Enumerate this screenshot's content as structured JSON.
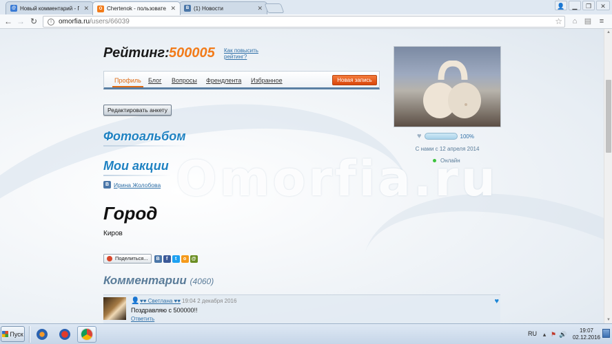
{
  "browser": {
    "tabs": [
      {
        "title": "Новый комментарий - Поч",
        "icon": "mail-icon"
      },
      {
        "title": "Chertenok - пользовател",
        "icon": "omorfia-icon"
      },
      {
        "title": "(1) Новости",
        "icon": "vk-icon"
      }
    ],
    "url_host": "omorfia.ru",
    "url_path": "/users/66039"
  },
  "watermark": "Omorfia.ru",
  "rating": {
    "label": "Рейтинг:",
    "value": "500005",
    "improve_link": "Как повысить рейтинг?"
  },
  "profile_tabs": [
    "Профиль",
    "Блог",
    "Вопросы",
    "Френдлента",
    "Избранное"
  ],
  "new_post_button": "Новая запись",
  "edit_button": "Редактировать анкету",
  "sections": {
    "photo_album": "Фотоальбом",
    "my_promos": "Мои акции"
  },
  "vk_profile": {
    "name": "Ирина Жолобова"
  },
  "city": {
    "heading": "Город",
    "value": "Киров"
  },
  "share": {
    "label": "Поделиться..."
  },
  "comments": {
    "heading": "Комментарии",
    "count": "(4060)",
    "items": [
      {
        "author": "♥♥ Светлана ♥♥",
        "date": "19:04 2 декабря 2016",
        "text": "Поздравляю с 500000!!",
        "reply": "Ответить"
      }
    ]
  },
  "sidebar": {
    "like_percent": "100%",
    "member_since": "С нами с 12 апреля 2014",
    "status": "Онлайн"
  },
  "taskbar": {
    "start_label": "Пуск",
    "language": "RU",
    "time": "19:07",
    "date": "02.12.2016"
  },
  "colors": {
    "rating_value": "#f27b1a",
    "section_heading": "#1f82c2",
    "link": "#2e6fa7",
    "new_post_button": "#e05a1a",
    "online_dot": "#3cc23c"
  }
}
